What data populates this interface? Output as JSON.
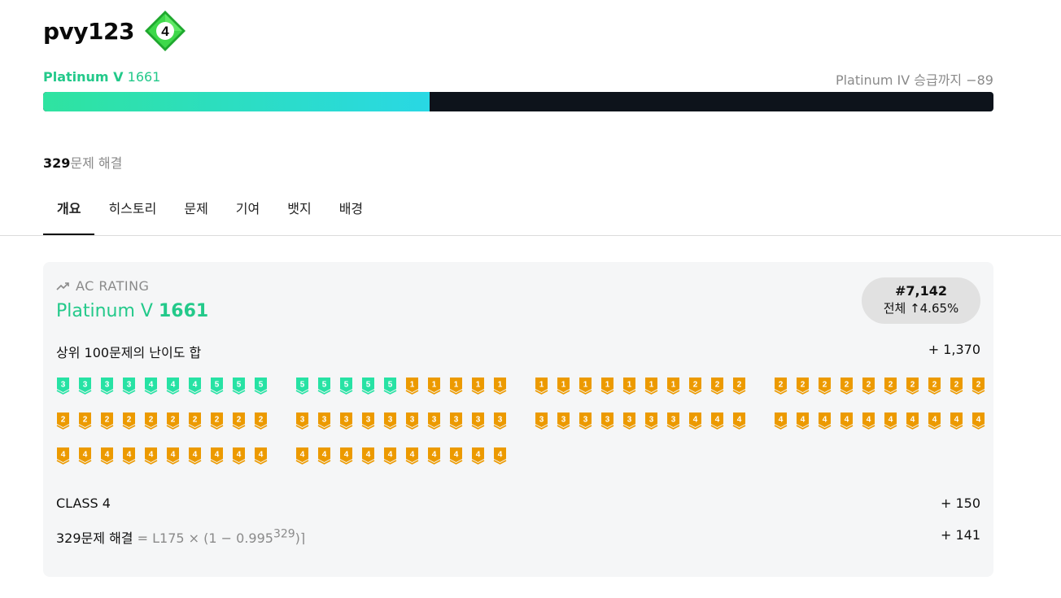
{
  "profile": {
    "username": "pvy123",
    "class_level": "4",
    "tier_name": "Platinum V",
    "rating": "1661",
    "next_tier_text": "Platinum IV 승급까지 −89",
    "progress_fraction": 0.407,
    "solved_count": "329",
    "solved_label": "문제 해결"
  },
  "tabs": [
    {
      "label": "개요",
      "active": true
    },
    {
      "label": "히스토리",
      "active": false
    },
    {
      "label": "문제",
      "active": false
    },
    {
      "label": "기여",
      "active": false
    },
    {
      "label": "뱃지",
      "active": false
    },
    {
      "label": "배경",
      "active": false
    }
  ],
  "ac": {
    "header": "AC RATING",
    "tier_name": "Platinum V",
    "rating": "1661",
    "rank": "#7,142",
    "rank_sub": "전체 ↑4.65%",
    "top100_label": "상위 100문제의 난이도 합",
    "top100_value": "+ 1,370",
    "class_label": "CLASS 4",
    "class_value": "+ 150",
    "solved_label": "329문제 해결",
    "solved_formula": "= L175 × (1 − 0.995",
    "solved_exp": "329",
    "solved_formula_end": ")⌉",
    "solved_value": "+ 141"
  },
  "badge_rows": [
    [
      [
        {
          "t": "plat",
          "n": "3"
        },
        {
          "t": "plat",
          "n": "3"
        },
        {
          "t": "plat",
          "n": "3"
        },
        {
          "t": "plat",
          "n": "3"
        },
        {
          "t": "plat",
          "n": "4"
        },
        {
          "t": "plat",
          "n": "4"
        },
        {
          "t": "plat",
          "n": "4"
        },
        {
          "t": "plat",
          "n": "5"
        },
        {
          "t": "plat",
          "n": "5"
        },
        {
          "t": "plat",
          "n": "5"
        }
      ],
      [
        {
          "t": "plat",
          "n": "5"
        },
        {
          "t": "plat",
          "n": "5"
        },
        {
          "t": "plat",
          "n": "5"
        },
        {
          "t": "plat",
          "n": "5"
        },
        {
          "t": "plat",
          "n": "5"
        },
        {
          "t": "gold",
          "n": "1"
        },
        {
          "t": "gold",
          "n": "1"
        },
        {
          "t": "gold",
          "n": "1"
        },
        {
          "t": "gold",
          "n": "1"
        },
        {
          "t": "gold",
          "n": "1"
        }
      ],
      [
        {
          "t": "gold",
          "n": "1"
        },
        {
          "t": "gold",
          "n": "1"
        },
        {
          "t": "gold",
          "n": "1"
        },
        {
          "t": "gold",
          "n": "1"
        },
        {
          "t": "gold",
          "n": "1"
        },
        {
          "t": "gold",
          "n": "1"
        },
        {
          "t": "gold",
          "n": "1"
        },
        {
          "t": "gold",
          "n": "2"
        },
        {
          "t": "gold",
          "n": "2"
        },
        {
          "t": "gold",
          "n": "2"
        }
      ],
      [
        {
          "t": "gold",
          "n": "2"
        },
        {
          "t": "gold",
          "n": "2"
        },
        {
          "t": "gold",
          "n": "2"
        },
        {
          "t": "gold",
          "n": "2"
        },
        {
          "t": "gold",
          "n": "2"
        },
        {
          "t": "gold",
          "n": "2"
        },
        {
          "t": "gold",
          "n": "2"
        },
        {
          "t": "gold",
          "n": "2"
        },
        {
          "t": "gold",
          "n": "2"
        },
        {
          "t": "gold",
          "n": "2"
        }
      ]
    ],
    [
      [
        {
          "t": "gold",
          "n": "2"
        },
        {
          "t": "gold",
          "n": "2"
        },
        {
          "t": "gold",
          "n": "2"
        },
        {
          "t": "gold",
          "n": "2"
        },
        {
          "t": "gold",
          "n": "2"
        },
        {
          "t": "gold",
          "n": "2"
        },
        {
          "t": "gold",
          "n": "2"
        },
        {
          "t": "gold",
          "n": "2"
        },
        {
          "t": "gold",
          "n": "2"
        },
        {
          "t": "gold",
          "n": "2"
        }
      ],
      [
        {
          "t": "gold",
          "n": "3"
        },
        {
          "t": "gold",
          "n": "3"
        },
        {
          "t": "gold",
          "n": "3"
        },
        {
          "t": "gold",
          "n": "3"
        },
        {
          "t": "gold",
          "n": "3"
        },
        {
          "t": "gold",
          "n": "3"
        },
        {
          "t": "gold",
          "n": "3"
        },
        {
          "t": "gold",
          "n": "3"
        },
        {
          "t": "gold",
          "n": "3"
        },
        {
          "t": "gold",
          "n": "3"
        }
      ],
      [
        {
          "t": "gold",
          "n": "3"
        },
        {
          "t": "gold",
          "n": "3"
        },
        {
          "t": "gold",
          "n": "3"
        },
        {
          "t": "gold",
          "n": "3"
        },
        {
          "t": "gold",
          "n": "3"
        },
        {
          "t": "gold",
          "n": "3"
        },
        {
          "t": "gold",
          "n": "3"
        },
        {
          "t": "gold",
          "n": "4"
        },
        {
          "t": "gold",
          "n": "4"
        },
        {
          "t": "gold",
          "n": "4"
        }
      ],
      [
        {
          "t": "gold",
          "n": "4"
        },
        {
          "t": "gold",
          "n": "4"
        },
        {
          "t": "gold",
          "n": "4"
        },
        {
          "t": "gold",
          "n": "4"
        },
        {
          "t": "gold",
          "n": "4"
        },
        {
          "t": "gold",
          "n": "4"
        },
        {
          "t": "gold",
          "n": "4"
        },
        {
          "t": "gold",
          "n": "4"
        },
        {
          "t": "gold",
          "n": "4"
        },
        {
          "t": "gold",
          "n": "4"
        }
      ]
    ],
    [
      [
        {
          "t": "gold",
          "n": "4"
        },
        {
          "t": "gold",
          "n": "4"
        },
        {
          "t": "gold",
          "n": "4"
        },
        {
          "t": "gold",
          "n": "4"
        },
        {
          "t": "gold",
          "n": "4"
        },
        {
          "t": "gold",
          "n": "4"
        },
        {
          "t": "gold",
          "n": "4"
        },
        {
          "t": "gold",
          "n": "4"
        },
        {
          "t": "gold",
          "n": "4"
        },
        {
          "t": "gold",
          "n": "4"
        }
      ],
      [
        {
          "t": "gold",
          "n": "4"
        },
        {
          "t": "gold",
          "n": "4"
        },
        {
          "t": "gold",
          "n": "4"
        },
        {
          "t": "gold",
          "n": "4"
        },
        {
          "t": "gold",
          "n": "4"
        },
        {
          "t": "gold",
          "n": "4"
        },
        {
          "t": "gold",
          "n": "4"
        },
        {
          "t": "gold",
          "n": "4"
        },
        {
          "t": "gold",
          "n": "4"
        },
        {
          "t": "gold",
          "n": "4"
        }
      ]
    ]
  ],
  "colors": {
    "platinum": "#27e2a4",
    "gold": "#ec9a00",
    "accent": "#23c98a",
    "progress_bg": "#0d131b"
  },
  "icons": {
    "class_badge": "class-diamond-icon",
    "trend": "trending-up-icon",
    "tier": "tier-badge-icon"
  }
}
